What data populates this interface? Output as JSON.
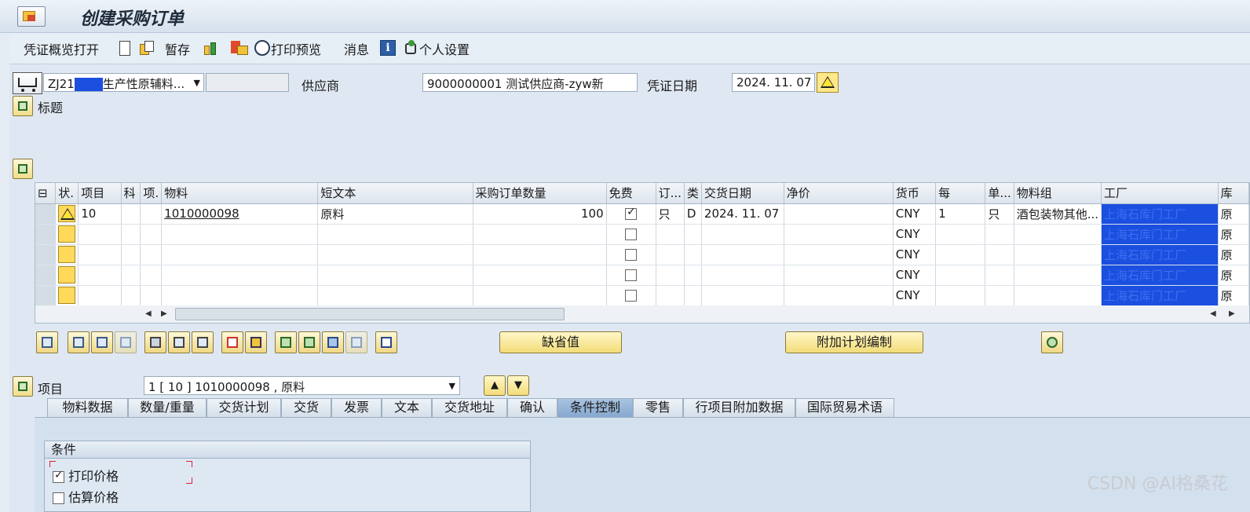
{
  "window": {
    "title": "创建采购订单"
  },
  "toolbar": {
    "overview_label": "凭证概览打开",
    "hold_label": "暂存",
    "print_preview_label": "打印预览",
    "messages_label": "消息",
    "personal_settings_label": "个人设置"
  },
  "header": {
    "doc_type_value": "ZJ21 ███生产性原辅料...",
    "doc_type_prefix": "ZJ21",
    "doc_type_suffix": "生产性原辅料...",
    "vendor_label": "供应商",
    "vendor_value": "9000000001 测试供应商-zyw新",
    "doc_date_label": "凭证日期",
    "doc_date_value": "2024. 11. 07",
    "header_label": "标题"
  },
  "grid": {
    "columns": [
      "状.",
      "项目",
      "科",
      "项.",
      "物料",
      "短文本",
      "采购订单数量",
      "免费",
      "订...",
      "类",
      "交货日期",
      "净价",
      "货币",
      "每",
      "单...",
      "物料组",
      "工厂",
      "库"
    ],
    "rows": [
      {
        "item": "10",
        "material": "1010000098",
        "short_text": "原料",
        "qty": "100",
        "free": true,
        "unit": "只",
        "cat": "D",
        "delivery_date": "2024. 11. 07",
        "currency": "CNY",
        "per": "1",
        "unit2": "只",
        "mat_group": "酒包装物其他...",
        "plant": "上海石库门工厂",
        "stor": "原"
      },
      {
        "item": "",
        "material": "",
        "short_text": "",
        "qty": "",
        "free": false,
        "unit": "",
        "cat": "",
        "delivery_date": "",
        "currency": "CNY",
        "per": "",
        "unit2": "",
        "mat_group": "",
        "plant": "上海石库门工厂",
        "stor": "原"
      },
      {
        "item": "",
        "material": "",
        "short_text": "",
        "qty": "",
        "free": false,
        "unit": "",
        "cat": "",
        "delivery_date": "",
        "currency": "CNY",
        "per": "",
        "unit2": "",
        "mat_group": "",
        "plant": "上海石库门工厂",
        "stor": "原"
      },
      {
        "item": "",
        "material": "",
        "short_text": "",
        "qty": "",
        "free": false,
        "unit": "",
        "cat": "",
        "delivery_date": "",
        "currency": "CNY",
        "per": "",
        "unit2": "",
        "mat_group": "",
        "plant": "上海石库门工厂",
        "stor": "原"
      },
      {
        "item": "",
        "material": "",
        "short_text": "",
        "qty": "",
        "free": false,
        "unit": "",
        "cat": "",
        "delivery_date": "",
        "currency": "CNY",
        "per": "",
        "unit2": "",
        "mat_group": "",
        "plant": "上海石库门工厂",
        "stor": "原"
      }
    ]
  },
  "actions": {
    "default_values_label": "缺省值",
    "additional_planning_label": "附加计划编制"
  },
  "item_detail": {
    "label": "项目",
    "selected_item": "1 [ 10 ] 1010000098 , 原料",
    "tabs": [
      "物料数据",
      "数量/重量",
      "交货计划",
      "交货",
      "发票",
      "文本",
      "交货地址",
      "确认",
      "条件控制",
      "零售",
      "行项目附加数据",
      "国际贸易术语"
    ],
    "active_tab": "条件控制"
  },
  "conditions": {
    "group_title": "条件",
    "print_price_label": "打印价格",
    "print_price_checked": true,
    "estimated_price_label": "估算价格",
    "estimated_price_checked": false
  },
  "watermark": "CSDN @AI格桑花"
}
